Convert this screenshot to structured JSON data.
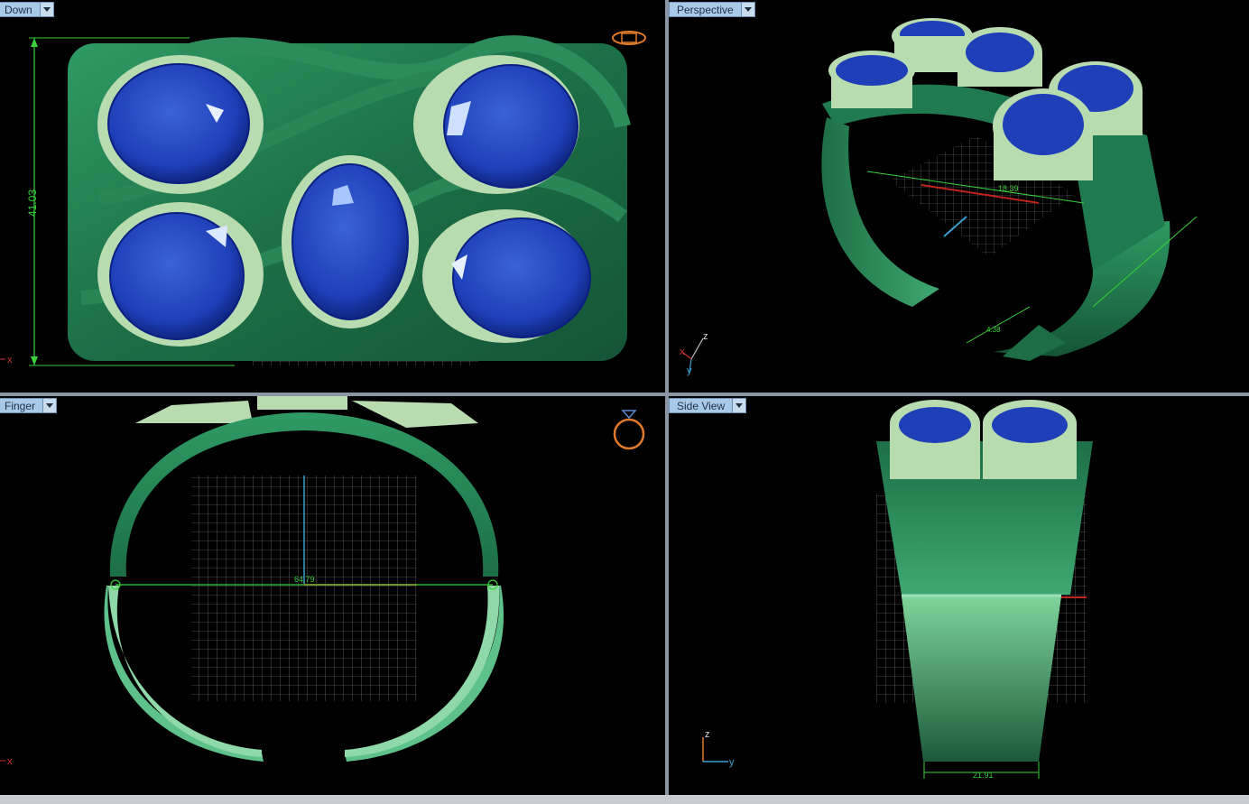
{
  "viewports": {
    "top_left": {
      "label": "Down",
      "dimension": "41.03",
      "axis_label": "x"
    },
    "top_right": {
      "label": "Perspective",
      "dimension_a": "18.39",
      "dimension_b": "4.38",
      "axis_z": "z",
      "axis_x": "x",
      "axis_y": "y"
    },
    "bottom_left": {
      "label": "Finger",
      "dimension": "64.79",
      "axis_label": "x"
    },
    "bottom_right": {
      "label": "Side View",
      "dimension": "21.91",
      "axis_z": "z",
      "axis_y": "y"
    }
  },
  "colors": {
    "metal": "#1f7a4f",
    "metal_light": "#3fa870",
    "bezel": "#b9dbb0",
    "gem": "#1e3fb8",
    "gem_dark": "#0b1f80",
    "dimension": "#3ad13a",
    "grid": "#9a9a9a",
    "label_bg": "#a9c9e8"
  },
  "icons": {
    "down_view": "ring-top-icon",
    "finger_view": "ring-icon"
  }
}
